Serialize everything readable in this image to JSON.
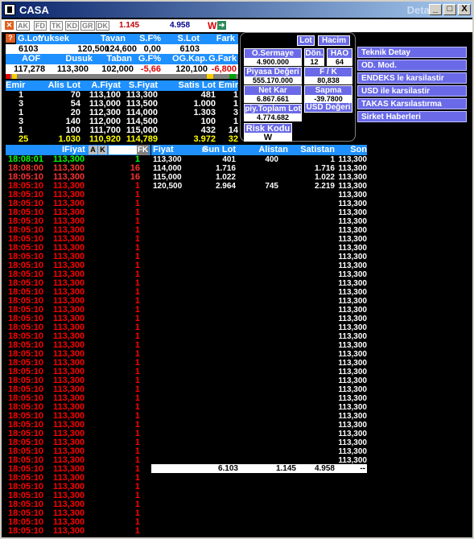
{
  "window": {
    "title": "CASA",
    "ghost_title": "Detay",
    "btn_min": "_",
    "btn_max": "□",
    "btn_close": "X"
  },
  "menubar": {
    "items": [
      "AK",
      "FD",
      "TK",
      "KD",
      "GR",
      "DK"
    ],
    "value_red": "1.145",
    "value_blue": "4.958",
    "w_label": "W"
  },
  "summary": {
    "headers1": [
      "G.Lot",
      "Yuksek",
      "Tavan",
      "S.F%",
      "S.Lot",
      "Fark"
    ],
    "values1": [
      "6103",
      "120,500",
      "124,600",
      "0,00",
      "6103",
      ""
    ],
    "headers2": [
      "AOF",
      "Dusuk",
      "Taban",
      "G.F%",
      "OG.Kap.",
      "G.Fark"
    ],
    "values2": [
      "117,278",
      "113,300",
      "102,000",
      "-5,66",
      "120,100",
      "-6,800"
    ]
  },
  "depth": {
    "headers": [
      "Emir",
      "Alis Lot",
      "A.Fiyat",
      "S.Fiyat",
      "Satis Lot",
      "Emir"
    ],
    "rows": [
      [
        "1",
        "70",
        "113,100",
        "113,300",
        "481",
        "1"
      ],
      [
        "3",
        "54",
        "113,000",
        "113,500",
        "1.000",
        "1"
      ],
      [
        "1",
        "20",
        "112,300",
        "114,000",
        "1.303",
        "3"
      ],
      [
        "3",
        "140",
        "112,000",
        "114,500",
        "100",
        "1"
      ],
      [
        "1",
        "100",
        "111,700",
        "115,000",
        "432",
        "14"
      ]
    ],
    "totals": [
      "25",
      "1.030",
      "110,920",
      "114,789",
      "3.972",
      "32"
    ]
  },
  "info_panel": {
    "tabs": [
      "Lot",
      "Hacim"
    ],
    "labels": {
      "sermaye": "Ö.Sermaye",
      "don": "Dön.",
      "hao": "HAO",
      "piyasa": "Piyasa Değeri",
      "fk": "F / K",
      "netkar": "Net Kar",
      "sapma": "Sapma",
      "toplamlot": "piy.Toplam Lot",
      "usd": "USD Değeri",
      "risk": "Risk Kodu"
    },
    "values": {
      "sermaye": "4.900.000",
      "don": "12",
      "hao": "64",
      "piyasa": "555.170.000",
      "fk": "80,838",
      "netkar": "6.867.661",
      "sapma": "-39.7800",
      "toplamlot": "4.774.682",
      "risk": "W"
    }
  },
  "right_menu": [
    "Teknik Detay",
    "OD. Mod.",
    "ENDEKS le karsilastir",
    "USD ile karsilastir",
    "TAKAS Karsılastırma",
    "Sirket Haberleri"
  ],
  "trades": {
    "header": "IFiyat",
    "btn_a": "A",
    "btn_k": "K",
    "btn_fk": "FK",
    "rows": [
      {
        "time": "18:08:01",
        "price": "113,300",
        "lot": "1",
        "color": "#00ff00"
      },
      {
        "time": "18:08:00",
        "price": "113,300",
        "lot": "16",
        "color": "#ff3030"
      },
      {
        "time": "18:05:10",
        "price": "113,300",
        "lot": "16",
        "color": "#ff3030"
      }
    ],
    "repeat_row": {
      "time": "18:05:10",
      "price": "113,300",
      "lot": "1"
    }
  },
  "distribution": {
    "headers": [
      "Fiyat",
      "Gun Lot",
      "Alistan",
      "Satistan",
      "Son"
    ],
    "rows": [
      [
        "113,300",
        "401",
        "400",
        "1",
        ""
      ],
      [
        "114,000",
        "1.716",
        "",
        "1.716",
        ""
      ],
      [
        "115,000",
        "1.022",
        "",
        "1.022",
        ""
      ],
      [
        "120,500",
        "2.964",
        "745",
        "2.219",
        ""
      ]
    ],
    "son_value": "113,300",
    "totals": [
      "6.103",
      "1.145",
      "4.958",
      "--"
    ]
  }
}
